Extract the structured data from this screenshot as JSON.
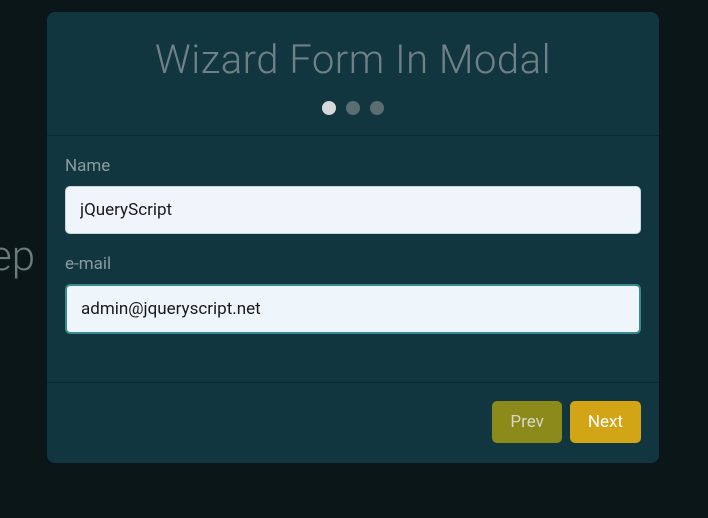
{
  "background": {
    "partial_text": "ep"
  },
  "modal": {
    "title": "Wizard Form In Modal",
    "steps": {
      "total": 3,
      "active_index": 0
    },
    "fields": {
      "name": {
        "label": "Name",
        "value": "jQueryScript"
      },
      "email": {
        "label": "e-mail",
        "value": "admin@jqueryscript.net"
      }
    },
    "buttons": {
      "prev": "Prev",
      "next": "Next"
    }
  }
}
